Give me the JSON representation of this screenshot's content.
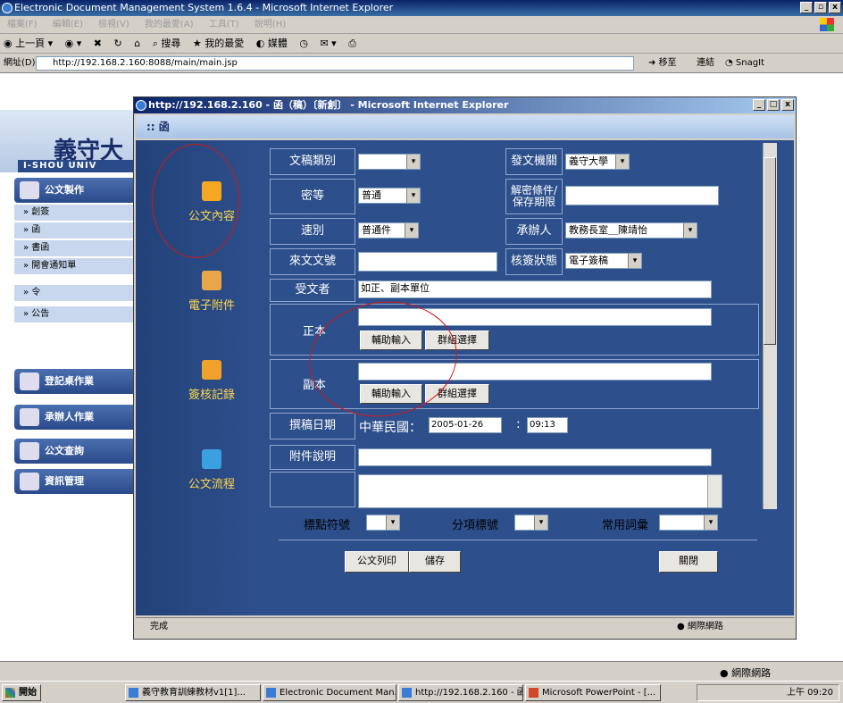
{
  "window": {
    "title": "Electronic Document Management System 1.6.4 - Microsoft Internet Explorer",
    "menu": [
      "檔案(F)",
      "編輯(E)",
      "檢視(V)",
      "我的最愛(A)",
      "工具(T)",
      "說明(H)"
    ],
    "toolbar": [
      "上一頁",
      "搜尋",
      "我的最愛",
      "媒體"
    ],
    "address_label": "網址(D)",
    "address": "http://192.168.2.160:8088/main/main.jsp",
    "go_label": "移至",
    "links_label": "連結",
    "snagit_label": "SnagIt"
  },
  "sidebar": {
    "university": "義守大",
    "university_en": "I-SHOU UNIV",
    "section_main": "公文製作",
    "items": [
      "創簽",
      "函",
      "書函",
      "開會通知單",
      "令",
      "公告"
    ],
    "sections": [
      "登記桌作業",
      "承辦人作業",
      "公文查詢",
      "資訊管理"
    ]
  },
  "popup": {
    "title": "http://192.168.2.160 - 函（稿）〔新創〕 - Microsoft Internet Explorer",
    "header": "函",
    "tools": [
      "公文內容",
      "電子附件",
      "簽核記錄",
      "公文流程"
    ],
    "status": "完成",
    "zone": "網際網路"
  },
  "form": {
    "doc_type_label": "文稿類別",
    "doc_type_value": "",
    "issuer_label": "發文機關",
    "issuer_value": "義守大學",
    "secret_label": "密等",
    "secret_value": "普通",
    "declass_label": "解密條件/保存期限",
    "declass_value": "",
    "speed_label": "速別",
    "speed_value": "普通件",
    "handler_label": "承辦人",
    "handler_value": "教務長室＿陳靖怡",
    "incoming_label": "來文文號",
    "incoming_value": "",
    "sign_status_label": "核簽狀態",
    "sign_status_value": "電子簽稿",
    "recipient_label": "受文者",
    "recipient_value": "如正、副本單位",
    "main_copy_label": "正本",
    "main_copy_value": "",
    "cc_label": "副本",
    "cc_value": "",
    "assist_button": "輔助輸入",
    "group_button": "群組選擇",
    "draft_date_label": "撰稿日期",
    "era_label": "中華民國：",
    "date_value": "2005-01-26",
    "time_sep": ":",
    "time_value": "09:13",
    "attach_label": "附件說明",
    "attach_value": "",
    "punct_label": "標點符號",
    "item_label": "分項標號",
    "phrase_label": "常用詞彙",
    "print_button": "公文列印",
    "save_button": "儲存",
    "close_button": "關閉"
  },
  "taskbar": {
    "start": "開始",
    "tasks": [
      "義守教育訓練教材v1[1]...",
      "Electronic Document Man...",
      "http://192.168.2.160 - 函...",
      "Microsoft PowerPoint - [..."
    ],
    "clock": "上午 09:20",
    "zone": "網際網路"
  }
}
